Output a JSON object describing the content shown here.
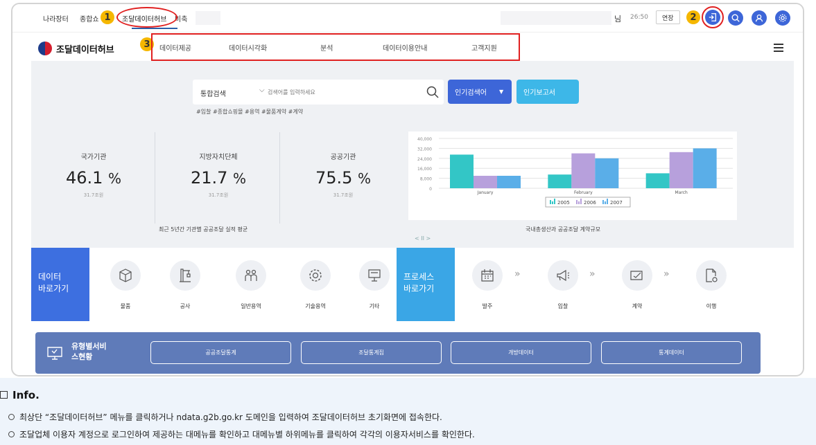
{
  "topbar": {
    "links": [
      "나라장터",
      "종합쇼",
      "조달데이터허브",
      "비축"
    ],
    "active": "조달데이터허브",
    "user_suffix": "님",
    "timer": "26:50",
    "extend_label": "연장",
    "badges": [
      "1",
      "2",
      "3"
    ]
  },
  "nav": {
    "logo_text": "조달데이터허브",
    "items": [
      "데이터제공",
      "데이터시각화",
      "분석",
      "데이터이용안내",
      "고객지원"
    ]
  },
  "search": {
    "category": "통합검색",
    "placeholder": "검색어를 입력하세요",
    "popular_keywords": "인기검색어",
    "popular_reports": "인기보고서",
    "tags": "#입찰  #종합쇼핑몰  #용역  #물품계약  #계약"
  },
  "stats": {
    "items": [
      {
        "label": "국가기관",
        "value": "46.1",
        "unit": "%",
        "sub": "31.7조원"
      },
      {
        "label": "지방자치단체",
        "value": "21.7",
        "unit": "%",
        "sub": "31.7조원"
      },
      {
        "label": "공공기관",
        "value": "75.5",
        "unit": "%",
        "sub": "31.7조원"
      }
    ],
    "caption": "최근 5년간 기관별 공공조달 실적 평균",
    "chart_caption": "국내총생산과 공공조달 계약규모",
    "slider_ctrl": "< II >"
  },
  "chart_data": {
    "type": "bar",
    "categories": [
      "January",
      "February",
      "March"
    ],
    "series": [
      {
        "name": "2005",
        "values": [
          27000,
          11000,
          12000
        ],
        "color": "#33c6c6"
      },
      {
        "name": "2006",
        "values": [
          10000,
          28000,
          29000
        ],
        "color": "#b7a0dc"
      },
      {
        "name": "2007",
        "values": [
          10000,
          24000,
          32000
        ],
        "color": "#5aaee8"
      }
    ],
    "ylim": [
      0,
      40000
    ],
    "yticks": [
      "40,000",
      "32,000",
      "24,000",
      "16,000",
      "8,000",
      "0"
    ],
    "legend_position": "bottom"
  },
  "shortcuts": {
    "data_head": "데이터\n바로가기",
    "data_items": [
      {
        "label": "물품",
        "icon": "box-icon"
      },
      {
        "label": "공사",
        "icon": "crane-icon"
      },
      {
        "label": "일반용역",
        "icon": "people-icon"
      },
      {
        "label": "기술용역",
        "icon": "gear-icon"
      },
      {
        "label": "기타",
        "icon": "presentation-icon"
      }
    ],
    "process_head": "프로세스\n바로가기",
    "process_items": [
      {
        "label": "발주",
        "icon": "calendar-icon"
      },
      {
        "label": "입찰",
        "icon": "megaphone-icon"
      },
      {
        "label": "계약",
        "icon": "contract-icon"
      },
      {
        "label": "이행",
        "icon": "document-gear-icon"
      }
    ],
    "arrow": "»"
  },
  "service": {
    "title": "유형별서비\n스현황",
    "buttons": [
      "공공조달통계",
      "조달통계집",
      "개방데이터",
      "통계데이터"
    ]
  },
  "info": {
    "title": "Info.",
    "lines": [
      "최상단 “조달데이터허브” 메뉴를 클릭하거나 ndata.g2b.go.kr 도메인을 입력하여 조달데이터허브 초기화면에 접속한다.",
      "조달업체 이용자 계정으로 로그인하여 제공하는 대메뉴를 확인하고 대메뉴별 하위메뉴를 클릭하여 각각의 이용자서비스를 확인한다."
    ]
  },
  "colors": {
    "accent_blue": "#3d66d8",
    "popular_keyword_btn": "#3d66d8",
    "popular_report_btn": "#3db7e8",
    "data_head_bg": "#3d6fe0",
    "process_head_bg": "#3aa6e6",
    "service_band": "#5f7bb9",
    "highlight_red": "#e02020",
    "badge_yellow": "#f5b700"
  }
}
